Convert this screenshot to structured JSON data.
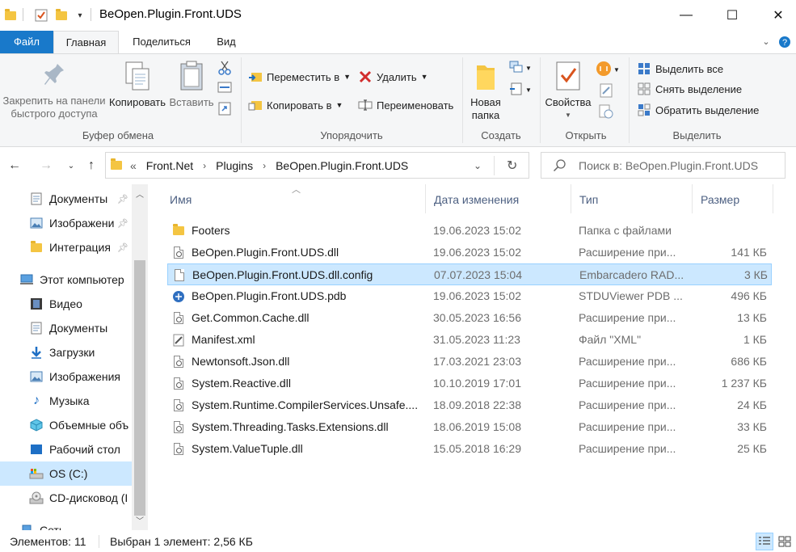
{
  "window": {
    "title": "BeOpen.Plugin.Front.UDS",
    "minimize": "—",
    "maximize": "☐",
    "close": "✕"
  },
  "ribbon_tabs": {
    "file": "Файл",
    "home": "Главная",
    "share": "Поделиться",
    "view": "Вид"
  },
  "clipboard": {
    "pin_label": "Закрепить на панели быстрого доступа",
    "pin_line1": "Закрепить на панели",
    "pin_line2": "быстрого доступа",
    "copy": "Копировать",
    "paste": "Вставить",
    "group": "Буфер обмена"
  },
  "organize": {
    "move_to": "Переместить в",
    "copy_to": "Копировать в",
    "delete": "Удалить",
    "rename": "Переименовать",
    "group": "Упорядочить"
  },
  "create": {
    "new_folder_line1": "Новая",
    "new_folder_line2": "папка",
    "group": "Создать"
  },
  "open": {
    "properties": "Свойства",
    "group": "Открыть"
  },
  "select": {
    "select_all": "Выделить все",
    "select_none": "Снять выделение",
    "invert": "Обратить выделение",
    "group": "Выделить"
  },
  "address": {
    "overflow": "«",
    "crumbs": [
      "Front.Net",
      "Plugins",
      "BeOpen.Plugin.Front.UDS"
    ]
  },
  "search": {
    "placeholder": "Поиск в: BeOpen.Plugin.Front.UDS"
  },
  "nav": [
    {
      "label": "Документы",
      "icon": "documents-icon",
      "pinned": true
    },
    {
      "label": "Изображени",
      "icon": "pictures-icon",
      "pinned": true
    },
    {
      "label": "Интеграция",
      "icon": "folder-icon",
      "pinned": true
    },
    {
      "label": "Этот компьютер",
      "icon": "computer-icon",
      "pinned": false
    },
    {
      "label": "Видео",
      "icon": "video-icon",
      "pinned": false
    },
    {
      "label": "Документы",
      "icon": "documents-icon",
      "pinned": false
    },
    {
      "label": "Загрузки",
      "icon": "downloads-icon",
      "pinned": false
    },
    {
      "label": "Изображения",
      "icon": "pictures-icon",
      "pinned": false
    },
    {
      "label": "Музыка",
      "icon": "music-icon",
      "pinned": false
    },
    {
      "label": "Объемные объ",
      "icon": "3d-objects-icon",
      "pinned": false
    },
    {
      "label": "Рабочий стол",
      "icon": "desktop-icon",
      "pinned": false
    },
    {
      "label": "OS (C:)",
      "icon": "drive-icon",
      "pinned": false
    },
    {
      "label": "CD-дисковод (I",
      "icon": "cd-drive-icon",
      "pinned": false
    },
    {
      "label": "Сеть",
      "icon": "network-icon",
      "pinned": false
    }
  ],
  "columns": {
    "name": "Имя",
    "date": "Дата изменения",
    "type": "Тип",
    "size": "Размер"
  },
  "files": [
    {
      "name": "Footers",
      "date": "19.06.2023 15:02",
      "type": "Папка с файлами",
      "size": "",
      "icon": "folder-icon"
    },
    {
      "name": "BeOpen.Plugin.Front.UDS.dll",
      "date": "19.06.2023 15:02",
      "type": "Расширение при...",
      "size": "141 КБ",
      "icon": "dll-icon"
    },
    {
      "name": "BeOpen.Plugin.Front.UDS.dll.config",
      "date": "07.07.2023 15:04",
      "type": "Embarcadero RAD...",
      "size": "3 КБ",
      "icon": "config-file-icon"
    },
    {
      "name": "BeOpen.Plugin.Front.UDS.pdb",
      "date": "19.06.2023 15:02",
      "type": "STDUViewer PDB ...",
      "size": "496 КБ",
      "icon": "pdb-file-icon"
    },
    {
      "name": "Get.Common.Cache.dll",
      "date": "30.05.2023 16:56",
      "type": "Расширение при...",
      "size": "13 КБ",
      "icon": "dll-icon"
    },
    {
      "name": "Manifest.xml",
      "date": "31.05.2023 11:23",
      "type": "Файл \"XML\"",
      "size": "1 КБ",
      "icon": "xml-file-icon"
    },
    {
      "name": "Newtonsoft.Json.dll",
      "date": "17.03.2021 23:03",
      "type": "Расширение при...",
      "size": "686 КБ",
      "icon": "dll-icon"
    },
    {
      "name": "System.Reactive.dll",
      "date": "10.10.2019 17:01",
      "type": "Расширение при...",
      "size": "1 237 КБ",
      "icon": "dll-icon"
    },
    {
      "name": "System.Runtime.CompilerServices.Unsafe....",
      "date": "18.09.2018 22:38",
      "type": "Расширение при...",
      "size": "24 КБ",
      "icon": "dll-icon"
    },
    {
      "name": "System.Threading.Tasks.Extensions.dll",
      "date": "18.06.2019 15:08",
      "type": "Расширение при...",
      "size": "33 КБ",
      "icon": "dll-icon"
    },
    {
      "name": "System.ValueTuple.dll",
      "date": "15.05.2018 16:29",
      "type": "Расширение при...",
      "size": "25 КБ",
      "icon": "dll-icon"
    }
  ],
  "selected_file": "BeOpen.Plugin.Front.UDS.dll.config",
  "status": {
    "count": "Элементов: 11",
    "selection": "Выбран 1 элемент: 2,56 КБ"
  },
  "colors": {
    "file_tab": "#1979ca",
    "selection": "#cce8ff",
    "selection_border": "#99d1ff",
    "header_text": "#4d6082"
  }
}
